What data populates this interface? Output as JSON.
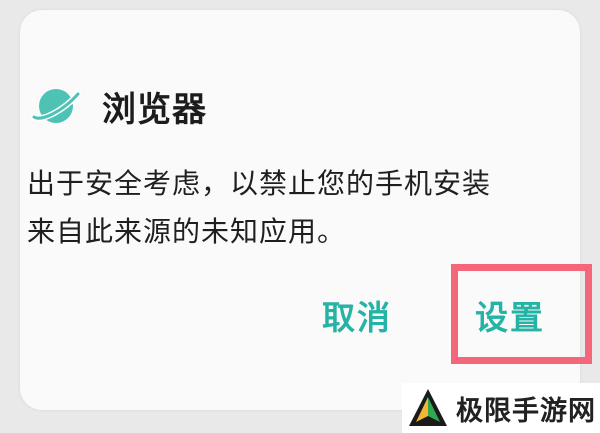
{
  "dialog": {
    "app_icon": "planet-browser-icon",
    "title": "浏览器",
    "message_line1": "出于安全考虑，以禁止您的手机安装",
    "message_line2": "来自此来源的未知应用。",
    "cancel_label": "取消",
    "settings_label": "设置"
  },
  "annotation": {
    "highlight_target": "设置",
    "color": "#f4677a"
  },
  "watermark": {
    "text": "极限手游网",
    "logo_icon": "triangle-logo-icon"
  },
  "colors": {
    "accent": "#25b3a6",
    "icon_teal": "#4ec2b5",
    "background": "#e9e9e9",
    "dialog": "#fafafa"
  }
}
